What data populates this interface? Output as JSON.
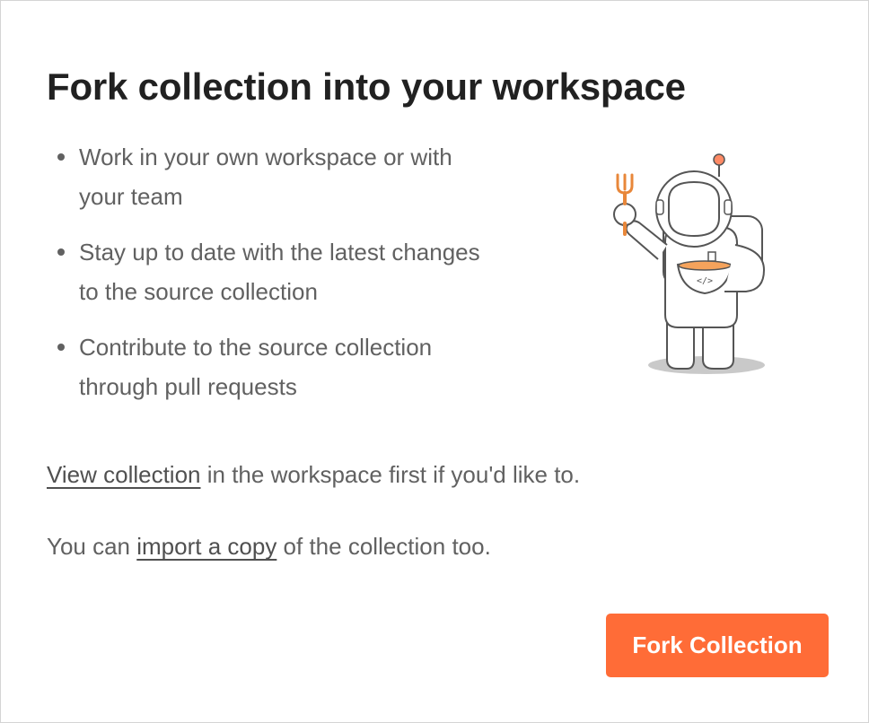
{
  "dialog": {
    "title": "Fork collection into your workspace",
    "benefits": [
      {
        "text": "Work in your own workspace or with your team"
      },
      {
        "text": "Stay up to date with the latest changes to the source collection"
      },
      {
        "text": "Contribute to the source collection through pull requests"
      }
    ],
    "view_line": {
      "link": "View collection",
      "rest": " in the workspace first if you'd like to."
    },
    "import_line": {
      "prefix": "You can ",
      "link": "import a copy",
      "suffix": " of the collection too."
    },
    "fork_button": "Fork Collection",
    "illustration": "astronaut-eating-icon"
  },
  "colors": {
    "accent": "#ff6c37",
    "title": "#212121",
    "body_text": "#616161",
    "border": "#d4d4d4"
  }
}
